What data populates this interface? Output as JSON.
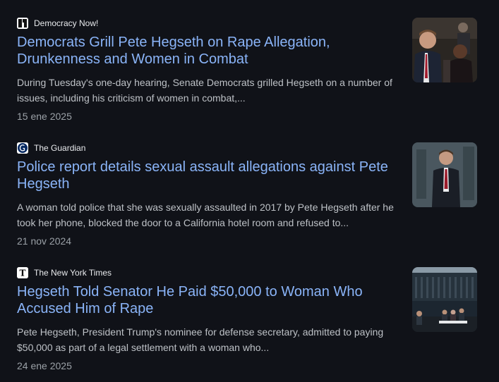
{
  "results": [
    {
      "source": "Democracy Now!",
      "favicon": "democracy-now-favicon-icon",
      "title": "Democrats Grill Pete Hegseth on Rape Allegation, Drunkenness and Women in Combat",
      "snippet": "During Tuesday's one-day hearing, Senate Democrats grilled Hegseth on a number of issues, including his criticism of women in combat,...",
      "date": "15 ene 2025"
    },
    {
      "source": "The Guardian",
      "favicon": "guardian-favicon-icon",
      "title": "Police report details sexual assault allegations against Pete Hegseth",
      "snippet": "A woman told police that she was sexually assaulted in 2017 by Pete Hegseth after he took her phone, blocked the door to a California hotel room and refused to...",
      "date": "21 nov 2024"
    },
    {
      "source": "The New York Times",
      "favicon": "nyt-favicon-icon",
      "title": "Hegseth Told Senator He Paid $50,000 to Woman Who Accused Him of Rape",
      "snippet": "Pete Hegseth, President Trump's nominee for defense secretary, admitted to paying $50,000 as part of a legal settlement with a woman who...",
      "date": "24 ene 2025"
    }
  ],
  "colors": {
    "background": "#101218",
    "title_link": "#8ab4f8",
    "snippet_text": "#bdc1c6",
    "date_text": "#9aa0a6",
    "source_text": "#e8eaed"
  }
}
